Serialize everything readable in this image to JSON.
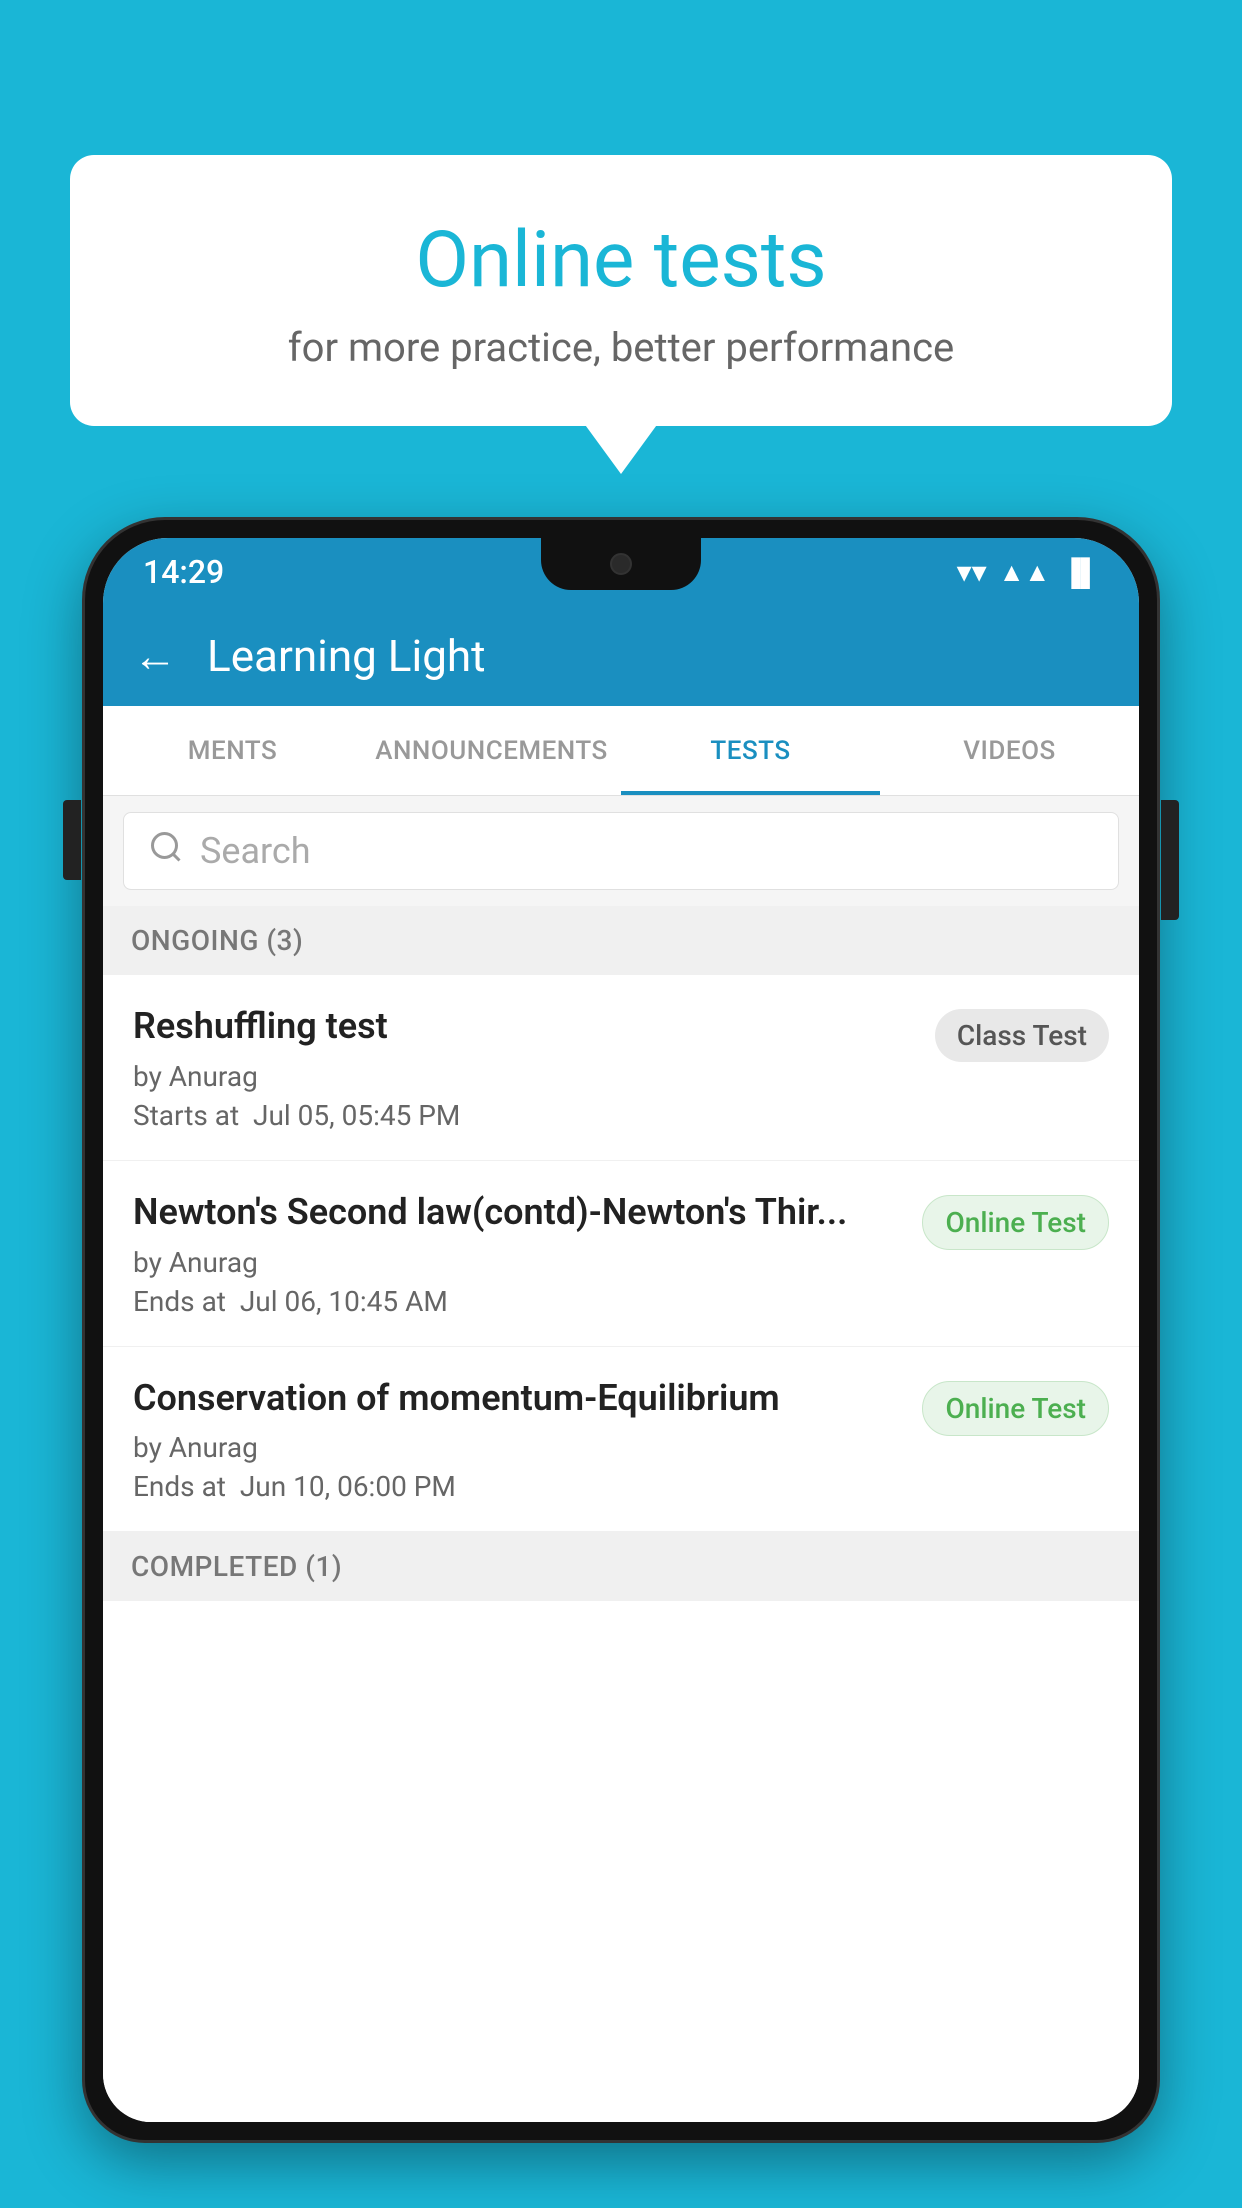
{
  "background_color": "#1ab6d6",
  "bubble": {
    "title": "Online tests",
    "subtitle": "for more practice, better performance"
  },
  "phone": {
    "status_bar": {
      "time": "14:29",
      "icons": [
        "wifi",
        "signal",
        "battery"
      ]
    },
    "header": {
      "back_label": "←",
      "title": "Learning Light"
    },
    "tabs": [
      {
        "label": "MENTS",
        "active": false
      },
      {
        "label": "ANNOUNCEMENTS",
        "active": false
      },
      {
        "label": "TESTS",
        "active": true
      },
      {
        "label": "VIDEOS",
        "active": false
      }
    ],
    "search": {
      "placeholder": "Search"
    },
    "ongoing_section": {
      "label": "ONGOING (3)"
    },
    "test_items": [
      {
        "name": "Reshuffling test",
        "by": "by Anurag",
        "time_label": "Starts at",
        "time": "Jul 05, 05:45 PM",
        "badge": "Class Test",
        "badge_type": "class"
      },
      {
        "name": "Newton's Second law(contd)-Newton's Thir...",
        "by": "by Anurag",
        "time_label": "Ends at",
        "time": "Jul 06, 10:45 AM",
        "badge": "Online Test",
        "badge_type": "online"
      },
      {
        "name": "Conservation of momentum-Equilibrium",
        "by": "by Anurag",
        "time_label": "Ends at",
        "time": "Jun 10, 06:00 PM",
        "badge": "Online Test",
        "badge_type": "online"
      }
    ],
    "completed_section": {
      "label": "COMPLETED (1)"
    }
  }
}
